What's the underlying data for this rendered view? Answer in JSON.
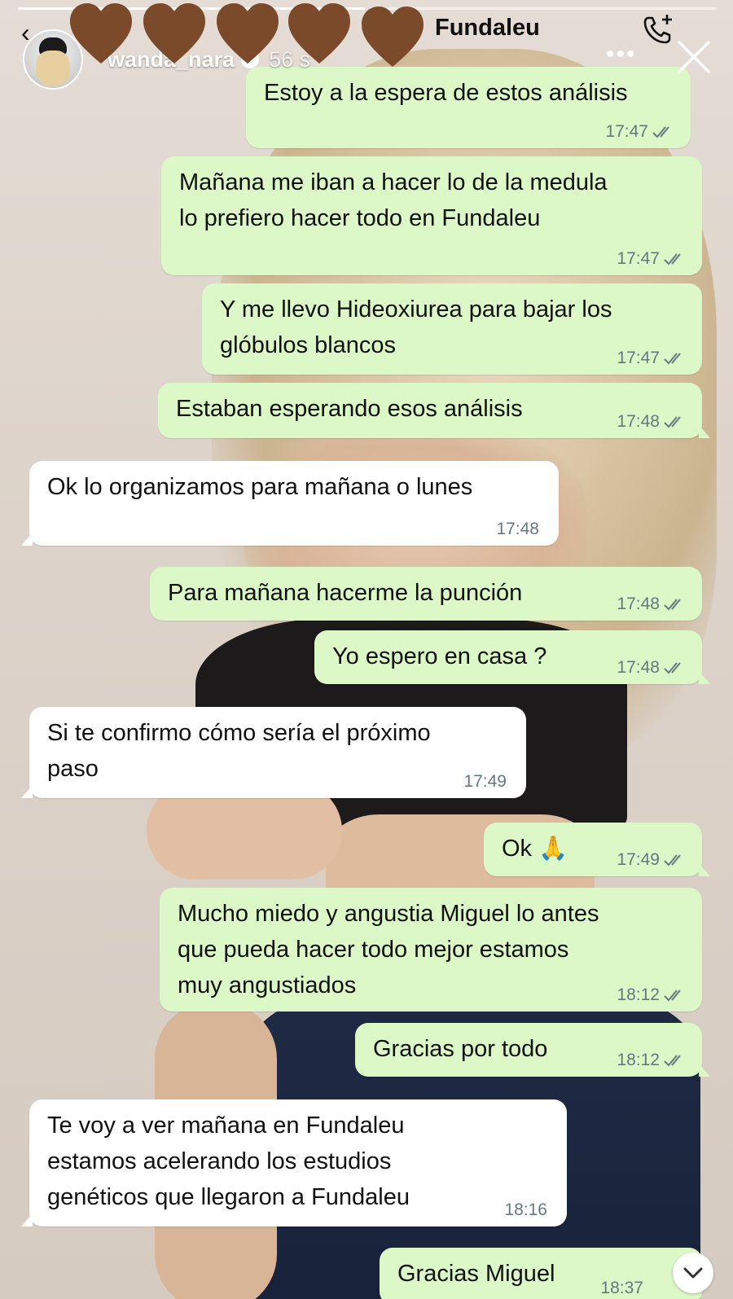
{
  "story": {
    "username": "wanda_nara",
    "time_ago": "56 s",
    "more_label": "•••"
  },
  "chat": {
    "contact_name": "Fundaleu",
    "back_icon": "chevron-left-icon",
    "call_icon": "phone-add-icon"
  },
  "stickers": {
    "heart_color": "#7a4a2b",
    "count": 5
  },
  "colors": {
    "outgoing_bubble": "#dcf8c6",
    "incoming_bubble": "#ffffff"
  },
  "messages": [
    {
      "dir": "out",
      "text": "Estoy a la espera de estos análisis",
      "time": "17:47"
    },
    {
      "dir": "out",
      "text": "Mañana me iban a hacer lo de la medula\nlo prefiero hacer todo en Fundaleu",
      "time": "17:47"
    },
    {
      "dir": "out",
      "text": "Y me llevo Hideoxiurea para bajar los\nglóbulos blancos",
      "time": "17:47"
    },
    {
      "dir": "out",
      "text": "Estaban esperando esos análisis",
      "time": "17:48"
    },
    {
      "dir": "in",
      "text": "Ok lo organizamos para mañana o lunes",
      "time": "17:48"
    },
    {
      "dir": "out",
      "text": "Para mañana hacerme la punción",
      "time": "17:48"
    },
    {
      "dir": "out",
      "text": "Yo espero en casa ?",
      "time": "17:48"
    },
    {
      "dir": "in",
      "text": "Si te confirmo cómo sería el próximo\npaso",
      "time": "17:49"
    },
    {
      "dir": "out",
      "text": "Ok 🙏",
      "time": "17:49"
    },
    {
      "dir": "out",
      "text": "Mucho miedo y angustia Miguel lo antes\nque pueda hacer todo mejor estamos\nmuy angustiados",
      "time": "18:12"
    },
    {
      "dir": "out",
      "text": "Gracias por todo",
      "time": "18:12"
    },
    {
      "dir": "in",
      "text": "Te voy a ver mañana en Fundaleu\nestamos acelerando los estudios\ngenéticos que llegaron a Fundaleu",
      "time": "18:16"
    },
    {
      "dir": "out",
      "text": "Gracias Miguel",
      "time": "18:37"
    }
  ]
}
